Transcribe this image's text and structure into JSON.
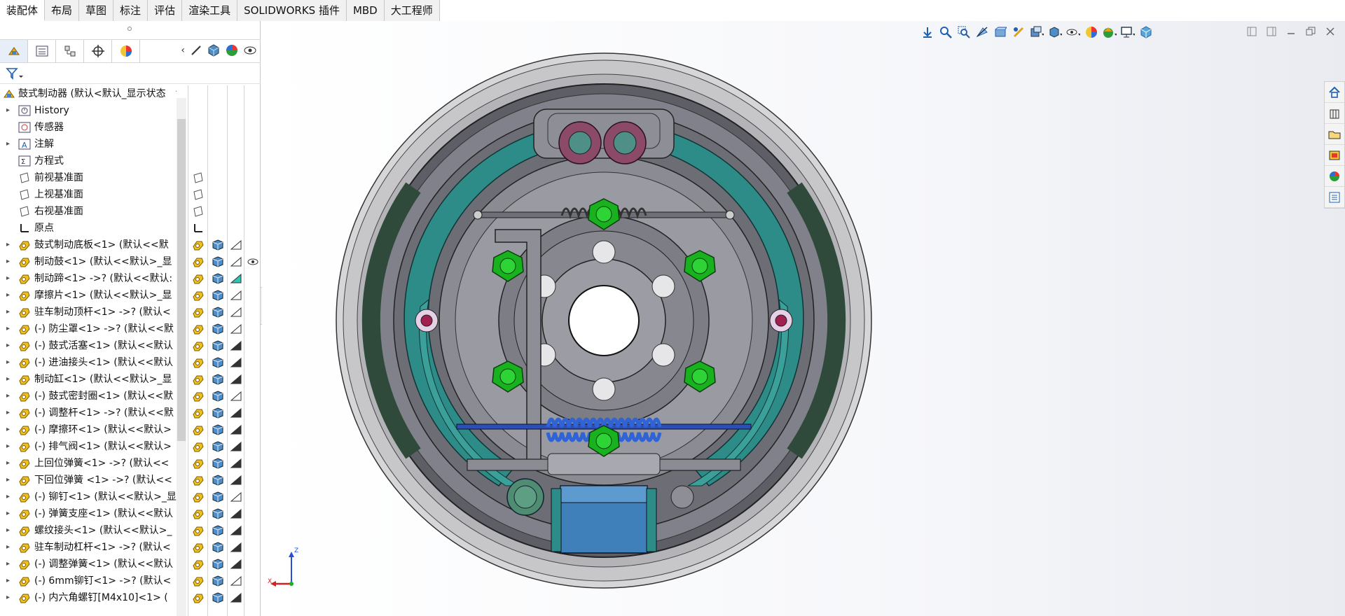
{
  "tabs": [
    {
      "label": "装配体",
      "active": true
    },
    {
      "label": "布局",
      "active": false
    },
    {
      "label": "草图",
      "active": false
    },
    {
      "label": "标注",
      "active": false
    },
    {
      "label": "评估",
      "active": false
    },
    {
      "label": "渲染工具",
      "active": false
    },
    {
      "label": "SOLIDWORKS 插件",
      "active": false
    },
    {
      "label": "MBD",
      "active": false
    },
    {
      "label": "大工程师",
      "active": false
    }
  ],
  "tree": {
    "root": "鼓式制动器 (默认<默认_显示状态",
    "items": [
      {
        "label": "History",
        "icon": "history-icon",
        "expand": true
      },
      {
        "label": "传感器",
        "icon": "sensor-icon",
        "expand": false
      },
      {
        "label": "注解",
        "icon": "annotation-icon",
        "expand": true
      },
      {
        "label": "方程式",
        "icon": "equation-icon",
        "expand": false
      },
      {
        "label": "前视基准面",
        "icon": "plane-icon",
        "expand": false
      },
      {
        "label": "上视基准面",
        "icon": "plane-icon",
        "expand": false
      },
      {
        "label": "右视基准面",
        "icon": "plane-icon",
        "expand": false
      },
      {
        "label": "原点",
        "icon": "origin-icon",
        "expand": false
      },
      {
        "label": "鼓式制动底板<1> (默认<<默",
        "icon": "part-icon",
        "expand": true
      },
      {
        "label": "制动鼓<1> (默认<<默认>_显",
        "icon": "part-icon",
        "expand": true
      },
      {
        "label": "制动蹄<1> ->? (默认<<默认:",
        "icon": "part-icon",
        "expand": true
      },
      {
        "label": "摩擦片<1> (默认<<默认>_显",
        "icon": "part-icon",
        "expand": true
      },
      {
        "label": "驻车制动顶杆<1> ->? (默认<",
        "icon": "part-icon",
        "expand": true
      },
      {
        "label": "(-) 防尘罩<1> ->? (默认<<默",
        "icon": "part-icon",
        "expand": true
      },
      {
        "label": "(-) 鼓式活塞<1> (默认<<默认",
        "icon": "part-icon",
        "expand": true
      },
      {
        "label": "(-) 进油接头<1> (默认<<默认",
        "icon": "part-icon",
        "expand": true
      },
      {
        "label": "制动缸<1> (默认<<默认>_显",
        "icon": "part-icon",
        "expand": true
      },
      {
        "label": "(-) 鼓式密封圈<1> (默认<<默",
        "icon": "part-icon",
        "expand": true
      },
      {
        "label": "(-) 调整杆<1> ->? (默认<<默",
        "icon": "part-icon",
        "expand": true
      },
      {
        "label": "(-) 摩擦环<1> (默认<<默认>",
        "icon": "part-icon",
        "expand": true
      },
      {
        "label": "(-) 排气阀<1> (默认<<默认>",
        "icon": "part-icon",
        "expand": true
      },
      {
        "label": "上回位弹簧<1> ->? (默认<<",
        "icon": "part-icon",
        "expand": true
      },
      {
        "label": "下回位弹簧 <1> ->? (默认<<",
        "icon": "part-icon",
        "expand": true
      },
      {
        "label": "(-) 铆钉<1> (默认<<默认>_显",
        "icon": "part-icon",
        "expand": true
      },
      {
        "label": "(-) 弹簧支座<1> (默认<<默认",
        "icon": "part-icon",
        "expand": true
      },
      {
        "label": "螺纹接头<1> (默认<<默认>_",
        "icon": "part-icon",
        "expand": true
      },
      {
        "label": "驻车制动杠杆<1> ->? (默认<",
        "icon": "part-icon",
        "expand": true
      },
      {
        "label": "(-) 调整弹簧<1> (默认<<默认",
        "icon": "part-icon",
        "expand": true
      },
      {
        "label": "(-) 6mm铆钉<1> ->? (默认<",
        "icon": "part-icon",
        "expand": true
      },
      {
        "label": "(-) 内六角螺钉[M4x10]<1> (",
        "icon": "part-icon",
        "expand": true
      }
    ]
  },
  "triad": {
    "z": "Z",
    "x": "X"
  },
  "colors": {
    "accent": "#2a6fb8",
    "shoe": "#2e8c88",
    "bolt": "#19b21f",
    "drum": "#a9a9ad",
    "backing": "#6a6a72"
  }
}
